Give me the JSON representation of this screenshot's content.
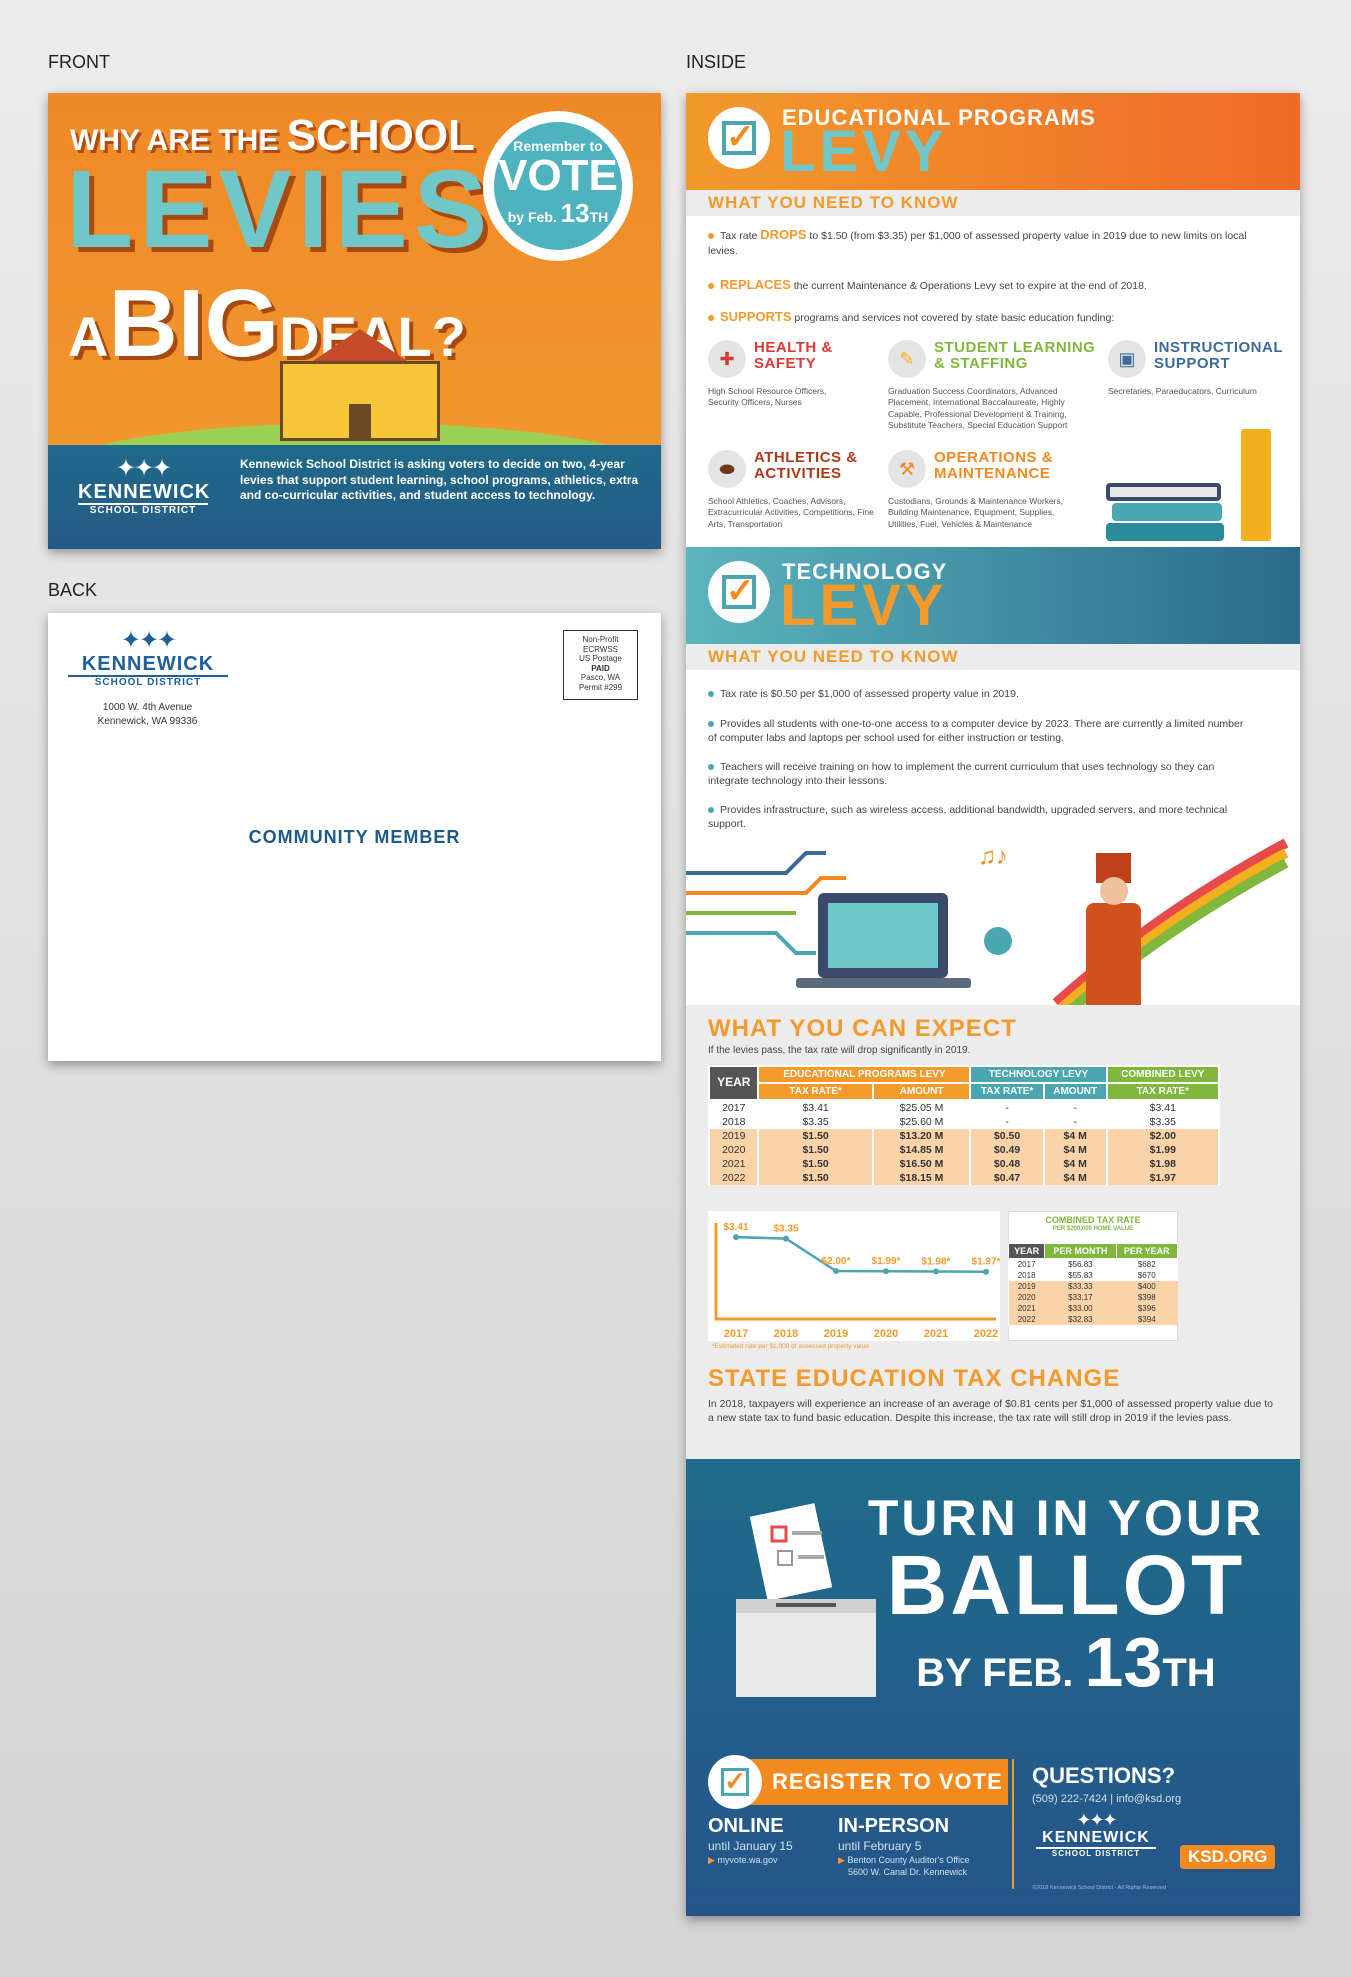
{
  "labels": {
    "front": "FRONT",
    "back": "BACK",
    "inside": "INSIDE"
  },
  "front": {
    "q_line1": "WHY ARE THE",
    "q_school": "SCHOOL",
    "levies": "LEVIES",
    "a": "A",
    "big": "BIG",
    "deal": "DEAL?",
    "seal": {
      "remember": "Remember to",
      "vote": "VOTE",
      "by": "by Feb.",
      "day": "13",
      "th": "TH"
    },
    "logo": {
      "name": "KENNEWICK",
      "sub": "SCHOOL DISTRICT"
    },
    "band_text": "Kennewick School District is asking voters to decide on two, 4-year levies that support student learning, school programs, athletics, extra and co-curricular activities, and student access to technology."
  },
  "back": {
    "logo": {
      "name": "KENNEWICK",
      "sub": "SCHOOL DISTRICT"
    },
    "address1": "1000 W. 4th Avenue",
    "address2": "Kennewick, WA 99336",
    "stamp": [
      "Non-Profit",
      "ECRWSS",
      "US Postage",
      "PAID",
      "Pasco, WA",
      "Permit #299"
    ],
    "recipient": "COMMUNITY MEMBER"
  },
  "inside": {
    "ed": {
      "title1": "EDUCATIONAL PROGRAMS",
      "title2": "LEVY",
      "wyn": "WHAT YOU NEED TO KNOW",
      "b1_pre": "Tax rate ",
      "b1_key": "DROPS",
      "b1_post": " to $1.50 (from $3.35) per $1,000 of assessed property value in 2019 due to new limits on local levies.",
      "b2_key": "REPLACES",
      "b2_post": " the current Maintenance & Operations Levy set to expire at the end of 2018.",
      "b3_key": "SUPPORTS",
      "b3_post": " programs and services not covered by state basic education funding:",
      "programs": [
        {
          "title": "HEALTH & SAFETY",
          "desc": "High School Resource Officers, Security Officers, Nurses",
          "color": "#d83a3a"
        },
        {
          "title": "STUDENT LEARNING & STAFFING",
          "desc": "Graduation Success Coordinators, Advanced Placement, International Baccalaureate, Highly Capable, Professional Development & Training, Substitute Teachers, Special Education Support",
          "color": "#7fb83c"
        },
        {
          "title": "INSTRUCTIONAL SUPPORT",
          "desc": "Secretaries, Paraeducators, Curriculum",
          "color": "#3c6a9a"
        },
        {
          "title": "ATHLETICS & ACTIVITIES",
          "desc": "School Athletics, Coaches, Advisors, Extracurricular Activities, Competitions, Fine Arts, Transportation",
          "color": "#b0381a"
        },
        {
          "title": "OPERATIONS & MAINTENANCE",
          "desc": "Custodians, Grounds & Maintenance Workers, Building Maintenance, Equipment, Supplies, Utilities, Fuel, Vehicles & Maintenance",
          "color": "#f28a20"
        }
      ]
    },
    "tech": {
      "title1": "TECHNOLOGY",
      "title2": "LEVY",
      "wyn": "WHAT YOU NEED TO KNOW",
      "bullets": [
        "Tax rate is $0.50 per $1,000 of assessed property value in 2019.",
        "Provides all students with one-to-one access to a computer device by 2023. There are currently a limited number of computer labs and laptops per school used for either instruction or testing.",
        "Teachers will receive training on how to implement the current curriculum that uses technology so they can integrate technology into their lessons.",
        "Provides infrastructure, such as wireless access, additional bandwidth, upgraded servers, and more technical support."
      ]
    },
    "expect": {
      "title": "WHAT YOU CAN EXPECT",
      "sub": "If the levies pass, the tax rate will drop significantly in 2019.",
      "head": {
        "year": "YEAR",
        "ed": "EDUCATIONAL PROGRAMS LEVY",
        "tech": "TECHNOLOGY LEVY",
        "comb": "COMBINED LEVY",
        "rate": "TAX RATE*",
        "amount": "AMOUNT"
      },
      "rows": [
        [
          "2017",
          "$3.41",
          "$25.05 M",
          "-",
          "-",
          "$3.41"
        ],
        [
          "2018",
          "$3.35",
          "$25.60 M",
          "-",
          "-",
          "$3.35"
        ],
        [
          "2019",
          "$1.50",
          "$13.20 M",
          "$0.50",
          "$4 M",
          "$2.00"
        ],
        [
          "2020",
          "$1.50",
          "$14.85 M",
          "$0.49",
          "$4 M",
          "$1.99"
        ],
        [
          "2021",
          "$1.50",
          "$16.50 M",
          "$0.48",
          "$4 M",
          "$1.98"
        ],
        [
          "2022",
          "$1.50",
          "$18.15 M",
          "$0.47",
          "$4 M",
          "$1.97"
        ]
      ],
      "chart_note": "*Estimated rate per $1,000 of assessed property value",
      "small": {
        "title": "COMBINED TAX RATE",
        "sub": "PER $200,000 HOME VALUE",
        "head": [
          "YEAR",
          "PER MONTH",
          "PER YEAR"
        ],
        "rows": [
          [
            "2017",
            "$56.83",
            "$682"
          ],
          [
            "2018",
            "$55.83",
            "$670"
          ],
          [
            "2019",
            "$33.33",
            "$400"
          ],
          [
            "2020",
            "$33.17",
            "$398"
          ],
          [
            "2021",
            "$33.00",
            "$396"
          ],
          [
            "2022",
            "$32.83",
            "$394"
          ]
        ]
      }
    },
    "state": {
      "title": "STATE EDUCATION TAX CHANGE",
      "text": "In 2018, taxpayers will experience an increase of an average of $0.81 cents per $1,000 of assessed property value due to a new state tax to fund basic education. Despite this increase, the tax rate will still drop in 2019 if the levies pass."
    },
    "ballot": {
      "l1": "TURN IN YOUR",
      "l2": "BALLOT",
      "l3": "BY FEB.",
      "day": "13",
      "th": "TH",
      "register": "REGISTER TO VOTE",
      "online": "ONLINE",
      "online_until": "until January 15",
      "online_link": "myvote.wa.gov",
      "inperson": "IN-PERSON",
      "inperson_until": "until February 5",
      "office1": "Benton County Auditor's Office",
      "office2": "5600 W. Canal Dr. Kennewick",
      "questions": "QUESTIONS?",
      "contact": "(509) 222-7424 | info@ksd.org",
      "logo_name": "KENNEWICK",
      "logo_sub": "SCHOOL DISTRICT",
      "site": "KSD.ORG",
      "copyright": "©2018 Kennewick School District - All Rights Reserved"
    }
  },
  "chart_data": {
    "type": "line",
    "x": [
      "2017",
      "2018",
      "2019",
      "2020",
      "2021",
      "2022"
    ],
    "series": [
      {
        "values": [
          3.41,
          3.35,
          2.0,
          1.99,
          1.98,
          1.97
        ]
      }
    ],
    "point_labels": [
      "$3.41",
      "$3.35",
      "$2.00*",
      "$1.99*",
      "$1.98*",
      "$1.97*"
    ],
    "ylim": [
      0,
      4
    ],
    "color": "#4aa6b0",
    "axis_color": "#f29a2c"
  }
}
